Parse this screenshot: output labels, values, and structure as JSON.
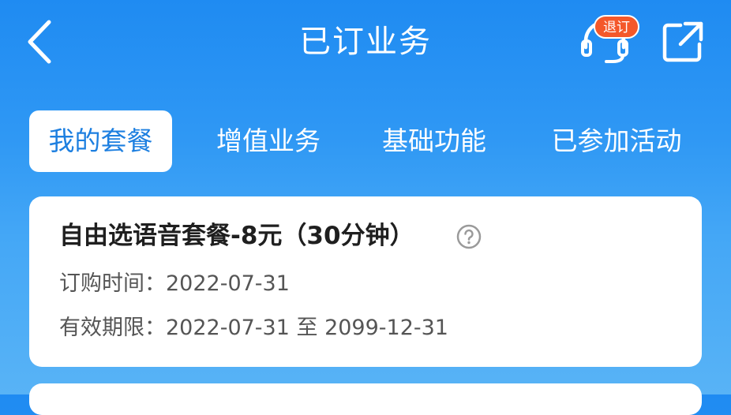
{
  "header": {
    "title": "已订业务",
    "unsubscribe_badge": "退订",
    "icons": {
      "back": "chevron-left-icon",
      "service": "headset-icon",
      "share": "share-external-icon"
    }
  },
  "tabs": [
    {
      "label": "我的套餐",
      "active": true
    },
    {
      "label": "增值业务",
      "active": false
    },
    {
      "label": "基础功能",
      "active": false
    },
    {
      "label": "已参加活动",
      "active": false
    }
  ],
  "card": {
    "title": "自由选语音套餐-8元（30分钟）",
    "order_time_label": "订购时间：",
    "order_time_value": "2022-07-31",
    "validity_label": "有效期限：",
    "validity_value": "2022-07-31 至 2099-12-31"
  },
  "colors": {
    "background_top": "#1f8bf2",
    "background_bottom": "#58b3f6",
    "active_tab_text": "#1d7fe0",
    "badge": "#f4582a"
  }
}
